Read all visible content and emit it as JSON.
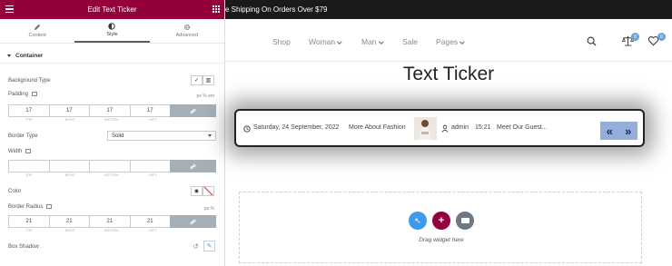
{
  "panel": {
    "title": "Edit Text Ticker",
    "tabs": [
      {
        "label": "Content",
        "icon": "pencil-icon"
      },
      {
        "label": "Style",
        "icon": "half-circle-icon",
        "active": true
      },
      {
        "label": "Advanced",
        "icon": "gear-icon"
      }
    ],
    "section": "Container",
    "background_type_label": "Background Type",
    "padding_label": "Padding",
    "padding_units": "px  %  em",
    "padding_values": [
      "17",
      "17",
      "17",
      "17"
    ],
    "dim_labels": [
      "TOP",
      "RIGHT",
      "BOTTOM",
      "LEFT"
    ],
    "border_type_label": "Border Type",
    "border_type_value": "Solid",
    "width_label": "Width",
    "width_values": [
      "",
      "",
      "",
      ""
    ],
    "color_label": "Color",
    "border_radius_label": "Border Radius",
    "border_radius_units": "px  %",
    "border_radius_values": [
      "21",
      "21",
      "21",
      "21"
    ],
    "box_shadow_label": "Box Shadow"
  },
  "preview": {
    "topbar_text": "e Shipping On Orders Over $79",
    "nav": [
      {
        "label": "Shop",
        "dropdown": false
      },
      {
        "label": "Woman",
        "dropdown": true
      },
      {
        "label": "Man",
        "dropdown": true
      },
      {
        "label": "Sale",
        "dropdown": false
      },
      {
        "label": "Pages",
        "dropdown": true
      }
    ],
    "compare_count": "0",
    "wishlist_count": "0",
    "page_title": "Text Ticker",
    "ticker": {
      "date": "Saturday, 24 September, 2022",
      "headline": "More About Fashion",
      "author": "admin",
      "time": "15:21",
      "next_headline": "Meet Our Guest...",
      "prev_arrow": "«",
      "next_arrow": "»"
    },
    "dropzone_text": "Drag widget here",
    "colors": {
      "brand": "#93003c",
      "ticker_nav": "#93aed8",
      "dz_blue": "#3d9aef",
      "dz_red": "#93003c",
      "dz_gray": "#6d7882"
    }
  }
}
